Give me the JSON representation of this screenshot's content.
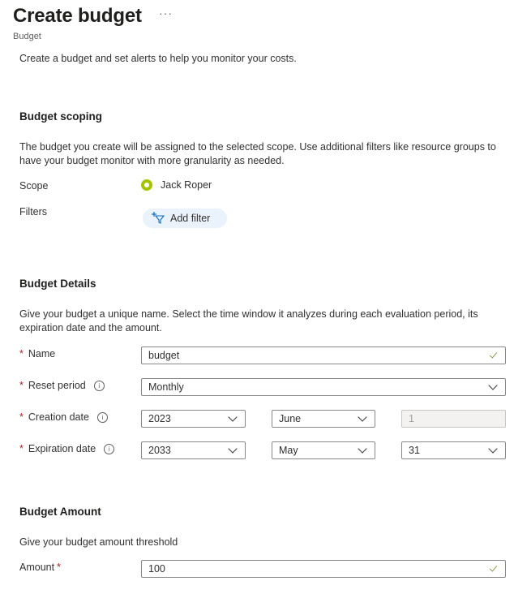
{
  "header": {
    "title": "Create budget",
    "more_label": "···",
    "subtitle": "Budget",
    "intro": "Create a budget and set alerts to help you monitor your costs."
  },
  "scoping": {
    "heading": "Budget scoping",
    "description": "The budget you create will be assigned to the selected scope. Use additional filters like resource groups to have your budget monitor with more granularity as needed.",
    "scope_label": "Scope",
    "scope_value": "Jack Roper",
    "filters_label": "Filters",
    "add_filter_label": "Add filter"
  },
  "details": {
    "heading": "Budget Details",
    "description": "Give your budget a unique name. Select the time window it analyzes during each evaluation period, its expiration date and the amount.",
    "required_mark": "*",
    "info_glyph": "i",
    "name_label": "Name",
    "name_value": "budget",
    "reset_label": "Reset period",
    "reset_value": "Monthly",
    "creation_label": "Creation date",
    "creation_year": "2023",
    "creation_month": "June",
    "creation_day": "1",
    "expiration_label": "Expiration date",
    "expiration_year": "2033",
    "expiration_month": "May",
    "expiration_day": "31"
  },
  "amount": {
    "heading": "Budget Amount",
    "description": "Give your budget amount threshold",
    "amount_label": "Amount",
    "required_mark": "*",
    "amount_value": "100"
  }
}
